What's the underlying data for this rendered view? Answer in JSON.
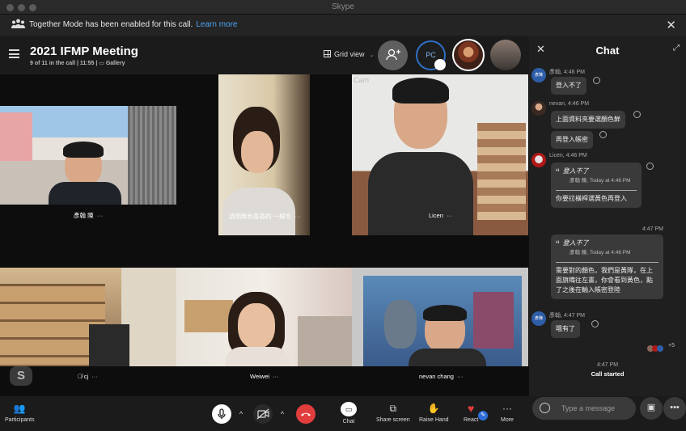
{
  "window": {
    "title": "Skype"
  },
  "banner": {
    "text": "Together Mode has been enabled for this call.",
    "link": "Learn more"
  },
  "meeting": {
    "title": "2021 IFMP Meeting",
    "status": "9 of 11 in the call | 11:55 |",
    "view": "Gallery",
    "grid_label": "Grid view"
  },
  "header": {
    "pc_initials": "PC"
  },
  "participants": [
    {
      "name": "彥翰 陳",
      "more": "···"
    },
    {
      "name": "透明無色香香的 一根毛",
      "more": "···"
    },
    {
      "name": "Licen",
      "more": "···"
    },
    {
      "name": "cj",
      "more": "···"
    },
    {
      "name": "Weiwei",
      "more": "···"
    },
    {
      "name": "nevan chang",
      "more": "···"
    }
  ],
  "tile_cam_label": "Cam",
  "skype_logo": "S",
  "chat": {
    "title": "Chat",
    "messages": [
      {
        "sender": "彥翰, 4:46 PM",
        "avatar_initials": "彥陳",
        "text": "登入不了"
      },
      {
        "sender": "nevan, 4:46 PM",
        "text1": "上面資料夾要選顏色鮮",
        "text2": "再登入帳密"
      },
      {
        "sender": "Licen, 4:46 PM",
        "quote_text": "登入不了",
        "quote_meta": "彥翰 陳, Today at 4:46 PM",
        "text": "你要拉橫桿選黃色再登入"
      },
      {
        "time": "4:47 PM",
        "quote_text": "登入不了",
        "quote_meta": "彥翰 陳, Today at 4:46 PM",
        "text": "需要對的顏色，我們是黃隊，在上面旗幟往左畫，你會看到黃色，點了之後在輸入帳密登陸"
      },
      {
        "sender": "彥翰, 4:47 PM",
        "avatar_initials": "彥陳",
        "text": "哦有了"
      }
    ],
    "seen_count": "+5",
    "system": {
      "time": "4:47 PM",
      "text": "Call started"
    },
    "placeholder": "Type a message"
  },
  "toolbar": {
    "participants": "Participants",
    "chat": "Chat",
    "share": "Share screen",
    "raise": "Raise Hand",
    "react": "React",
    "more": "More"
  },
  "colors": {
    "accent": "#4ea3f1",
    "end_call": "#e23d3d",
    "bubble": "#3a3a3a"
  }
}
